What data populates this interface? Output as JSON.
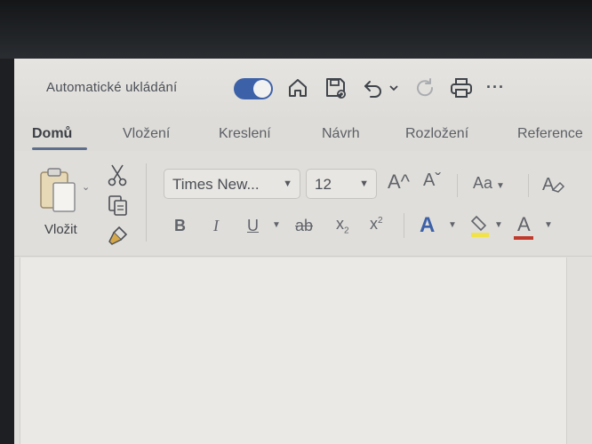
{
  "titlebar": {
    "autosave_label": "Automatické ukládání",
    "autosave_on": true,
    "icons": [
      "home-icon",
      "save-icon",
      "undo-icon",
      "chevron-down-icon",
      "redo-icon",
      "print-icon",
      "more-icon"
    ],
    "more_label": "···"
  },
  "tabs": [
    {
      "label": "Domů",
      "active": true
    },
    {
      "label": "Vložení",
      "active": false
    },
    {
      "label": "Kreslení",
      "active": false
    },
    {
      "label": "Návrh",
      "active": false
    },
    {
      "label": "Rozložení",
      "active": false
    },
    {
      "label": "Reference",
      "active": false
    }
  ],
  "clipboard": {
    "paste_label": "Vložit",
    "icons": [
      "paste-icon",
      "cut-icon",
      "copy-icon",
      "format-painter-icon"
    ]
  },
  "font": {
    "family": "Times New...",
    "size": "12",
    "grow_icon": "A^",
    "shrink_icon": "Aˇ",
    "case_label": "Aa",
    "clear_formatting_icon": "clear-formatting-icon"
  },
  "format": {
    "bold": "B",
    "italic": "I",
    "underline": "U",
    "strikethrough": "ab",
    "subscript": "x",
    "subscript_mark": "2",
    "superscript": "x",
    "superscript_mark": "2",
    "text_effects": "A",
    "highlight_color": "#f2e24a",
    "font_color_letter": "A",
    "font_color": "#c0392b"
  },
  "colors": {
    "accent": "#3d61a8",
    "ribbon_bg": "#e0deda",
    "page_bg": "#ebe9e5"
  }
}
